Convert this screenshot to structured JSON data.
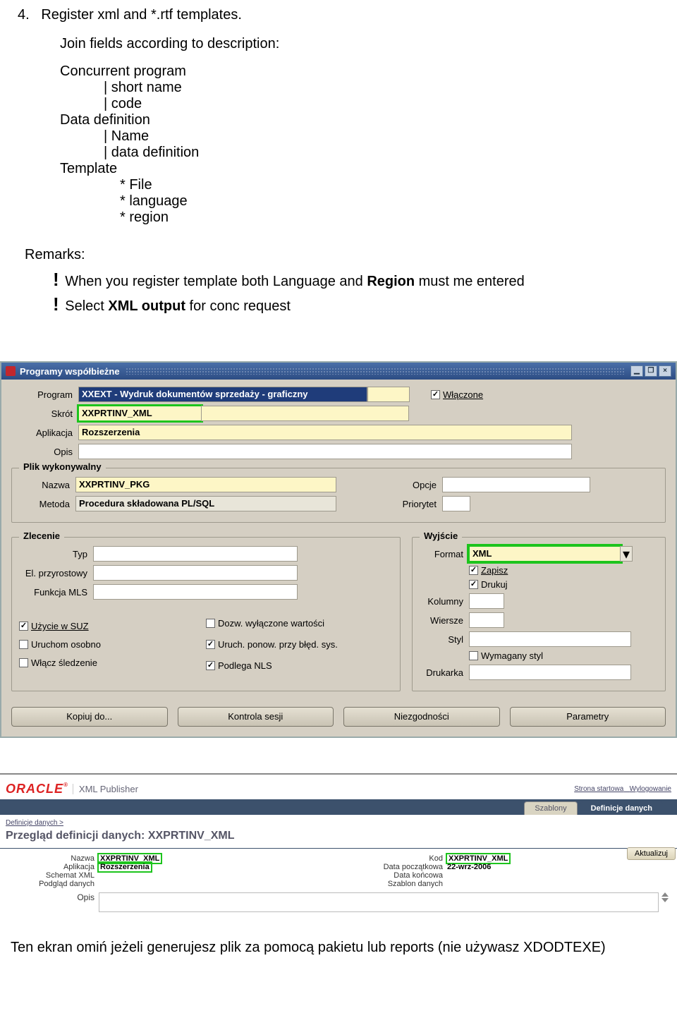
{
  "step_num": "4.",
  "step_text": "Register xml and *.rtf templates.",
  "intro": "Join fields according to description:",
  "tree": {
    "cp": "Concurrent program",
    "shortname": "| short name",
    "code": "| code",
    "dd": "Data definition",
    "ddname": "| Name",
    "dddef": "| data definition",
    "tpl": "Template",
    "file": "* File",
    "lang": "* language",
    "region": "* region"
  },
  "remarks_title": "Remarks:",
  "remark1_a": "When you register template both Language and ",
  "remark1_b": "Region",
  "remark1_c": " must me entered",
  "remark2": "Select ",
  "remark2_b": "XML output",
  "remark2_c": " for conc request",
  "forms": {
    "title": "Programy współbieżne",
    "min": "–",
    "rest": "▢",
    "close": "×",
    "program_lbl": "Program",
    "program_val": "XXEXT - Wydruk dokumentów sprzedaży - graficzny",
    "wlaczone": "Włączone",
    "skrot_lbl": "Skrót",
    "skrot_val": "XXPRTINV_XML",
    "app_lbl": "Aplikacja",
    "app_val": "Rozszerzenia",
    "opis_lbl": "Opis",
    "plik_legend": "Plik wykonywalny",
    "nazwa_lbl": "Nazwa",
    "nazwa_val": "XXPRTINV_PKG",
    "opcje_lbl": "Opcje",
    "metoda_lbl": "Metoda",
    "metoda_val": "Procedura składowana PL/SQL",
    "prio_lbl": "Priorytet",
    "zlecenie_legend": "Zlecenie",
    "typ_lbl": "Typ",
    "elp_lbl": "El. przyrostowy",
    "mls_lbl": "Funkcja MLS",
    "wyjscie_legend": "Wyjście",
    "format_lbl": "Format",
    "format_val": "XML",
    "zapisz": "Zapisz",
    "drukuj": "Drukuj",
    "kolumny_lbl": "Kolumny",
    "wiersze_lbl": "Wiersze",
    "styl_lbl": "Styl",
    "wymstyl": "Wymagany styl",
    "drukarka_lbl": "Drukarka",
    "c_suz": "Użycie w SUZ",
    "c_osobno": "Uruchom osobno",
    "c_sledz": "Włącz śledzenie",
    "c_dozw": "Dozw. wyłączone wartości",
    "c_uruch": "Uruch. ponow. przy błęd. sys.",
    "c_nls": "Podlega NLS",
    "btn_kopiuj": "Kopiuj do...",
    "btn_kontrola": "Kontrola sesji",
    "btn_niezg": "Niezgodności",
    "btn_param": "Parametry"
  },
  "xmlp": {
    "oracle": "ORACLE",
    "pub": "XML Publisher",
    "strona": "Strona startowa",
    "wylog": "Wylogowanie",
    "tab1": "Szablony",
    "tab2": "Definicje danych",
    "crumb": "Definicje danych  >",
    "header": "Przegląd definicji danych: XXPRTINV_XML",
    "aktualizuj": "Aktualizuj",
    "nazwa_lbl": "Nazwa",
    "nazwa_val": "XXPRTINV_XML",
    "app_lbl": "Aplikacja",
    "app_val": "Rozszerzenia",
    "schema_lbl": "Schemat XML",
    "podglad_lbl": "Podgląd danych",
    "kod_lbl": "Kod",
    "kod_val": "XXPRTINV_XML",
    "dp_lbl": "Data początkowa",
    "dp_val": "22-wrz-2006",
    "dk_lbl": "Data końcowa",
    "sz_lbl": "Szablon danych",
    "opis_lbl": "Opis"
  },
  "footer": "Ten ekran omiń jeżeli generujesz plik za pomocą pakietu lub reports (nie używasz XDODTEXE)"
}
